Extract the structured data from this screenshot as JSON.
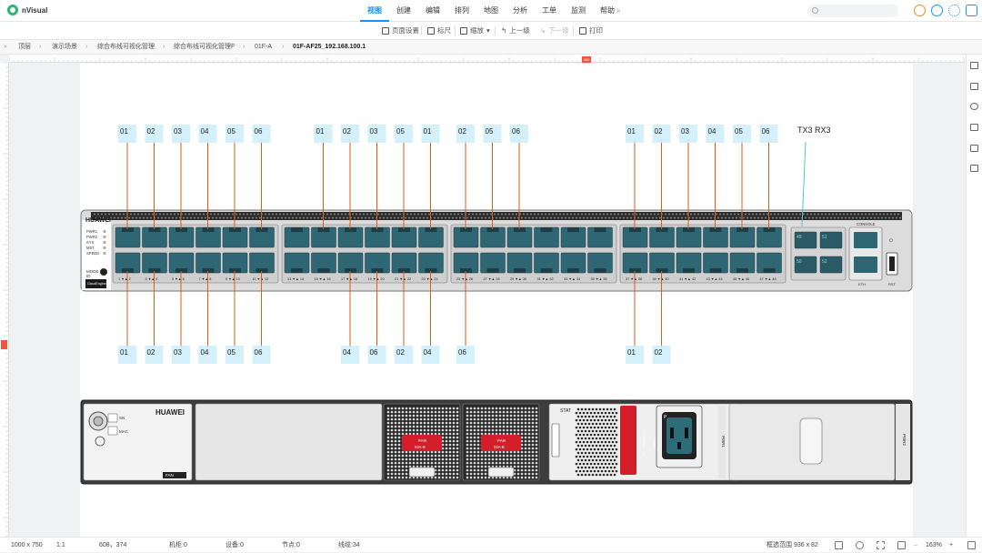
{
  "app": {
    "name": "nVisual"
  },
  "menu": [
    "视图",
    "创建",
    "编辑",
    "排列",
    "地图",
    "分析",
    "工单",
    "监测",
    "帮助"
  ],
  "menu_more": "»",
  "toolbar": {
    "page_setup": "页面设置",
    "ruler": "标尺",
    "zoom": "缩放",
    "up": "上一级",
    "down": "下一级",
    "print": "打印"
  },
  "breadcrumb": [
    "顶层",
    "演示场景",
    "综合布线可视化管理",
    "综合布线可视化管理F",
    "01F-A",
    "01F-AF25_192.168.100.1"
  ],
  "ruler": {
    "h_marker": "400"
  },
  "device_top": {
    "brand": "HUAWEI",
    "leds": [
      "PWR1",
      "PWR2",
      "SYS",
      "MST",
      "SPEED"
    ],
    "mode_label": "MODE",
    "id_label": "ID",
    "cloud_badge": "CloudEngine",
    "console": "CONSOLE",
    "port_numbers": [
      "1",
      "2",
      "3",
      "4",
      "5",
      "6",
      "7",
      "8",
      "9",
      "10",
      "11",
      "12",
      "13",
      "14",
      "15",
      "16",
      "17",
      "18",
      "19",
      "20",
      "21",
      "22",
      "23",
      "24",
      "25",
      "26",
      "27",
      "28",
      "29",
      "30",
      "31",
      "32",
      "33",
      "34",
      "35",
      "36",
      "37",
      "38",
      "39",
      "40",
      "41",
      "42",
      "43",
      "44",
      "45",
      "46",
      "47",
      "48"
    ],
    "sfp_numbers": [
      "49",
      "51",
      "50",
      "52"
    ],
    "eth_label": "ETH",
    "rst_label": "RST"
  },
  "labels_top": [
    "01",
    "02",
    "03",
    "04",
    "05",
    "06",
    "01",
    "02",
    "03",
    "05",
    "01",
    "02",
    "05",
    "06",
    "01",
    "02",
    "03",
    "04",
    "05",
    "06"
  ],
  "label_txrx": "TX3 RX3",
  "labels_bottom": [
    "01",
    "02",
    "03",
    "04",
    "05",
    "06",
    "04",
    "06",
    "02",
    "04",
    "06",
    "01",
    "02"
  ],
  "device_bottom": {
    "brand": "HUAWEI",
    "sn": "SN",
    "mac": "MAC",
    "fan_tag": "FAN",
    "fan_module": "FAN",
    "fan_model": "02A-B",
    "stat": "STAT",
    "pwr_module": "PWR",
    "pwr_model": "PAC600S12-CB",
    "pwr_label": "PWR1",
    "pwr2_label": "PWR2"
  },
  "status": {
    "page_size": "1000 x 750",
    "scale": "1:1",
    "coords": "608，374",
    "cabinets": "机柜:0",
    "devices": "设备:0",
    "nodes": "节点:0",
    "links": "线缆:34",
    "selection": "框选范围 936 x 82",
    "zoom": "163%"
  },
  "colors": {
    "accent": "#1890ff",
    "cable": "#d95f1a",
    "port": "#2f6674",
    "label_bg": "#cdeefa",
    "chassis": "#3c3c3c"
  }
}
